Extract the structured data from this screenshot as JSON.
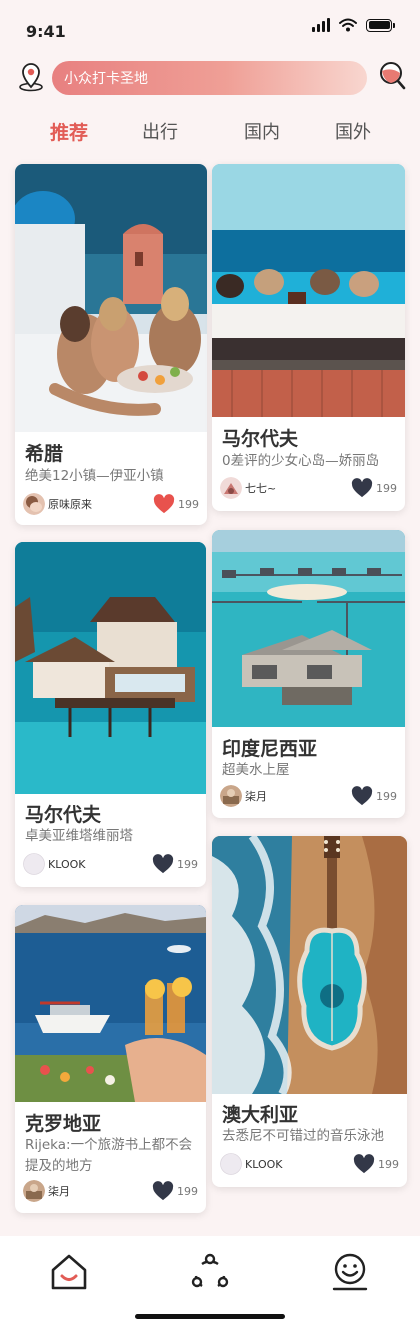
{
  "status": {
    "time": "9:41"
  },
  "search": {
    "placeholder": "小众打卡圣地"
  },
  "tabs": [
    {
      "label": "推荐",
      "active": true
    },
    {
      "label": "出行",
      "active": false
    },
    {
      "label": "国内",
      "active": false
    },
    {
      "label": "国外",
      "active": false
    }
  ],
  "cards": [
    {
      "title": "希腊",
      "subtitle": "绝美12小镇—伊亚小镇",
      "author": "原味原来",
      "likes": "199",
      "liked": true
    },
    {
      "title": "马尔代夫",
      "subtitle": "0差评的少女心岛—娇丽岛",
      "author": "七七~",
      "likes": "199",
      "liked": false
    },
    {
      "title": "马尔代夫",
      "subtitle": "卓美亚维塔维丽塔",
      "author": "KLOOK",
      "likes": "199",
      "liked": false
    },
    {
      "title": "印度尼西亚",
      "subtitle": "超美水上屋",
      "author": "柒月",
      "likes": "199",
      "liked": false
    },
    {
      "title": "克罗地亚",
      "subtitle": "Rijeka:一个旅游书上都不会提及的地方",
      "author": "柒月",
      "likes": "199",
      "liked": false
    },
    {
      "title": "澳大利亚",
      "subtitle": "去悉尼不可错过的音乐泳池",
      "author": "KLOOK",
      "likes": "199",
      "liked": false
    }
  ],
  "nav": {
    "items": [
      "home-icon",
      "share-icon",
      "profile-smile-icon"
    ]
  },
  "colors": {
    "accent": "#e25c56",
    "heart_active": "#e8524d",
    "heart_inactive": "#333848",
    "background": "#fbf3f3"
  }
}
